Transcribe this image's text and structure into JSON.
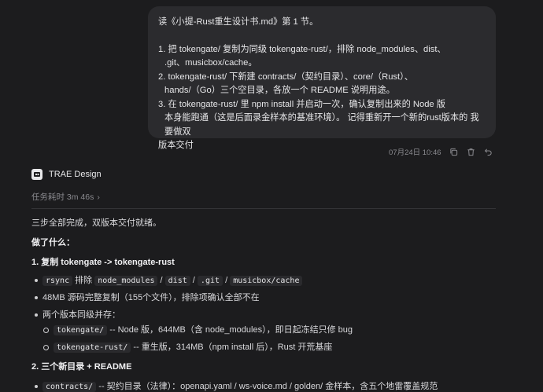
{
  "user_message": {
    "intro": "读《小提-Rust重生设计书.md》第 1 节。",
    "line1a": "1. 把 tokengate/ 复制为同级 tokengate-rust/，排除 node_modules、dist、",
    "line1b": ".git、musicbox/cache。",
    "line2a": "2. tokengate-rust/ 下新建 contracts/（契约目录）、core/（Rust）、",
    "line2b": "hands/（Go）三个空目录，各放一个 README 说明用途。",
    "line3a": "3. 在 tokengate-rust/ 里 npm install 并启动一次，确认复制出来的 Node 版",
    "line3b": "本身能跑通（这是后面录金样本的基准环境）。 记得重新开一个新的rust版本的 我要做双",
    "line3c": "版本交付"
  },
  "meta": {
    "timestamp": "07月24日 10:46"
  },
  "assistant": {
    "name": "TRAE Design",
    "task_time": "任务耗时 3m 46s",
    "chevron": "›"
  },
  "response": {
    "summary": "三步全部完成，双版本交付就绪。",
    "what_done": "做了什么：",
    "sec1_title": "1. 复制 tokengate -> tokengate-rust",
    "b1_code1": "rsync",
    "b1_t1": " 排除 ",
    "b1_code2": "node_modules",
    "b1_sep1": " / ",
    "b1_code3": "dist",
    "b1_sep2": " / ",
    "b1_code4": ".git",
    "b1_sep3": " / ",
    "b1_code5": "musicbox/cache",
    "b2": "48MB 源码完整复制（155个文件），排除项确认全部不在",
    "b3": "两个版本同级并存：",
    "s1_code": "tokengate/",
    "s1_text": " -- Node 版，644MB（含 node_modules），即日起冻结只修 bug",
    "s2_code": "tokengate-rust/",
    "s2_text": " -- 重生版，314MB（npm install 后），Rust 开荒基座",
    "sec2_title": "2. 三个新目录 + README",
    "c1_code": "contracts/",
    "c1_text": " -- 契约目录（法律）：openapi.yaml / ws-voice.md / golden/ 金样本，含五个地雷覆盖规范"
  }
}
